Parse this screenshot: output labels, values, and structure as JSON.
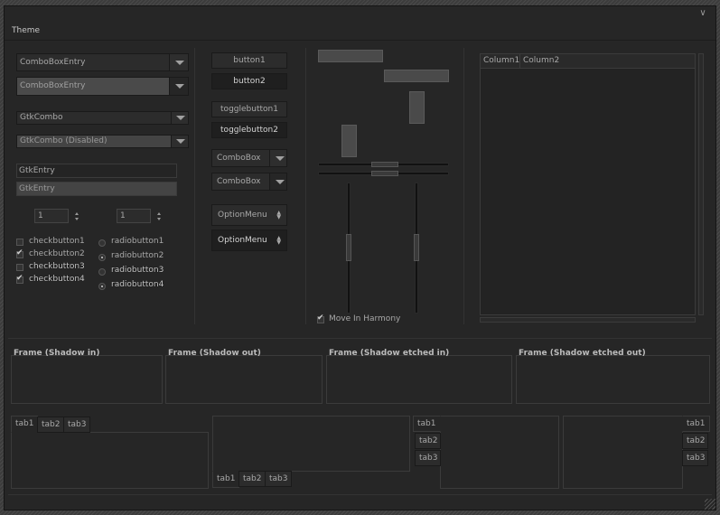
{
  "window": {
    "menu_glyph": "∨"
  },
  "theme_bar": {
    "label": "Theme"
  },
  "combos": {
    "combo_entry_1": "ComboBoxEntry",
    "combo_entry_2": "ComboBoxEntry",
    "gtk_combo": "GtkCombo",
    "gtk_combo_disabled": "GtkCombo (Disabled)"
  },
  "entries": {
    "entry_1": "GtkEntry",
    "entry_2": "GtkEntry"
  },
  "spinbuttons": {
    "spin_1": "1",
    "spin_2": "1"
  },
  "checkbuttons": [
    {
      "label": "checkbutton1",
      "checked": false
    },
    {
      "label": "checkbutton2",
      "checked": true
    },
    {
      "label": "checkbutton3",
      "checked": false
    },
    {
      "label": "checkbutton4",
      "checked": true
    }
  ],
  "radiobuttons": [
    {
      "label": "radiobutton1",
      "checked": false
    },
    {
      "label": "radiobutton2",
      "checked": true
    },
    {
      "label": "radiobutton3",
      "checked": false
    },
    {
      "label": "radiobutton4",
      "checked": true
    }
  ],
  "buttons": {
    "button1": "button1",
    "button2": "button2",
    "togglebutton1": "togglebutton1",
    "togglebutton2": "togglebutton2",
    "combobox_1": "ComboBox",
    "combobox_2": "ComboBox",
    "optionmenu_1": "OptionMenu",
    "optionmenu_2": "OptionMenu"
  },
  "scales": {
    "move_in_harmony": "Move In Harmony"
  },
  "treeview": {
    "columns": [
      "Column1",
      "Column2"
    ]
  },
  "frames": [
    "Frame (Shadow in)",
    "Frame (Shadow out)",
    "Frame (Shadow etched in)",
    "Frame (Shadow etched out)"
  ],
  "notebooks": {
    "tabs": [
      "tab1",
      "tab2",
      "tab3"
    ]
  }
}
